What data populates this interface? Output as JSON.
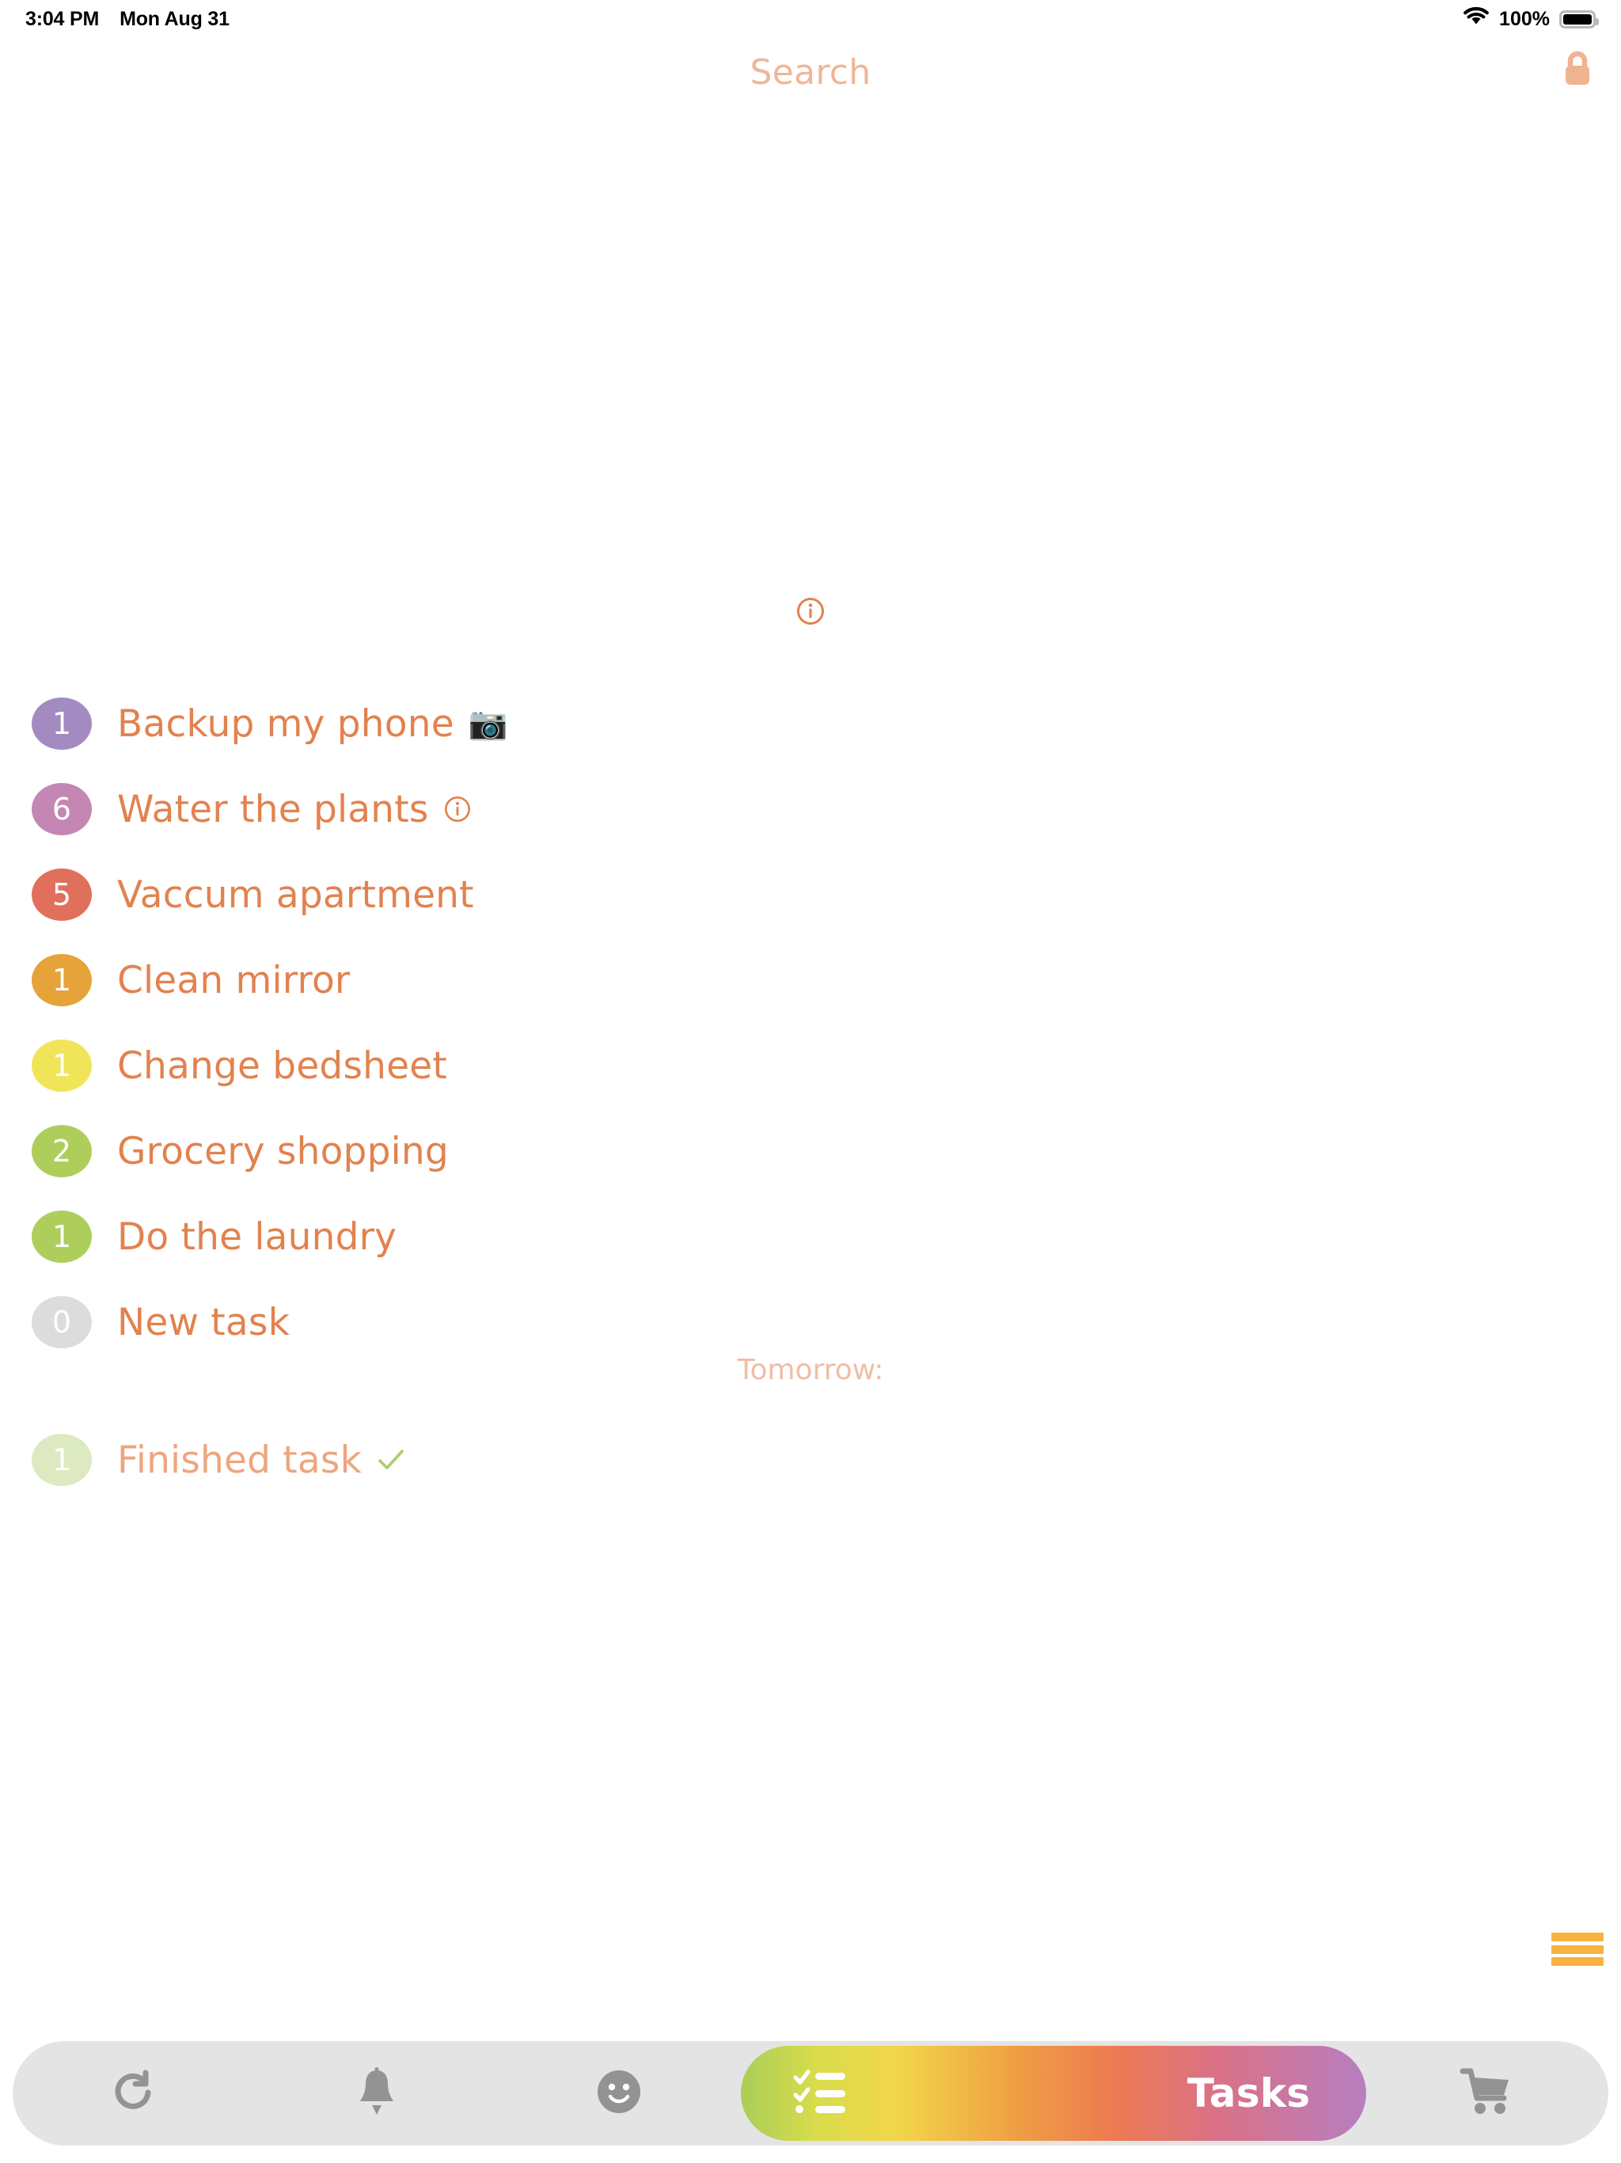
{
  "status_bar": {
    "time": "3:04 PM",
    "date": "Mon Aug 31",
    "battery_percent": "100%",
    "wifi_icon": "wifi-icon",
    "battery_icon": "battery-full-icon"
  },
  "header": {
    "search_placeholder": "Search",
    "lock_icon": "lock-closed-icon",
    "lock_color": "#f0b391"
  },
  "center": {
    "info_icon": "info-circle-icon",
    "info_color": "#e2824f"
  },
  "tasks": {
    "items": [
      {
        "count": "1",
        "label": "Backup my phone",
        "badge_color": "#a38bc2",
        "suffix": "📷",
        "suffix_icon": "camera-emoji"
      },
      {
        "count": "6",
        "label": "Water the plants",
        "badge_color": "#c487b3",
        "suffix": "ⓘ",
        "suffix_icon": "info-circle-icon"
      },
      {
        "count": "5",
        "label": "Vaccum apartment",
        "badge_color": "#e0705c",
        "suffix": "",
        "suffix_icon": ""
      },
      {
        "count": "1",
        "label": "Clean mirror",
        "badge_color": "#e5a339",
        "suffix": "",
        "suffix_icon": ""
      },
      {
        "count": "1",
        "label": "Change bedsheet",
        "badge_color": "#f0e559",
        "suffix": "",
        "suffix_icon": ""
      },
      {
        "count": "2",
        "label": "Grocery shopping",
        "badge_color": "#aece5c",
        "suffix": "",
        "suffix_icon": ""
      },
      {
        "count": "1",
        "label": "Do the laundry",
        "badge_color": "#aece5c",
        "suffix": "",
        "suffix_icon": ""
      },
      {
        "count": "0",
        "label": "New task",
        "badge_color": "#dcdcdc",
        "suffix": "",
        "suffix_icon": ""
      }
    ],
    "text_color": "#e2824f"
  },
  "tomorrow": {
    "label": "Tomorrow:"
  },
  "finished": {
    "count": "1",
    "label": "Finished task",
    "badge_color": "#c2da8f",
    "check_icon": "check-mark-icon",
    "check_color": "#a8d06a"
  },
  "menu": {
    "hamburger_icon": "hamburger-menu-icon",
    "color": "#f9b23f"
  },
  "tabbar": {
    "tabs": [
      {
        "icon": "refresh-icon",
        "label": ""
      },
      {
        "icon": "bell-icon",
        "label": ""
      },
      {
        "icon": "smiley-face-icon",
        "label": ""
      }
    ],
    "active": {
      "icon": "checklist-icon",
      "label": "Tasks"
    },
    "trailing": {
      "icon": "shopping-cart-icon",
      "label": ""
    },
    "icon_color": "#939393",
    "background": "#e4e4e4"
  }
}
